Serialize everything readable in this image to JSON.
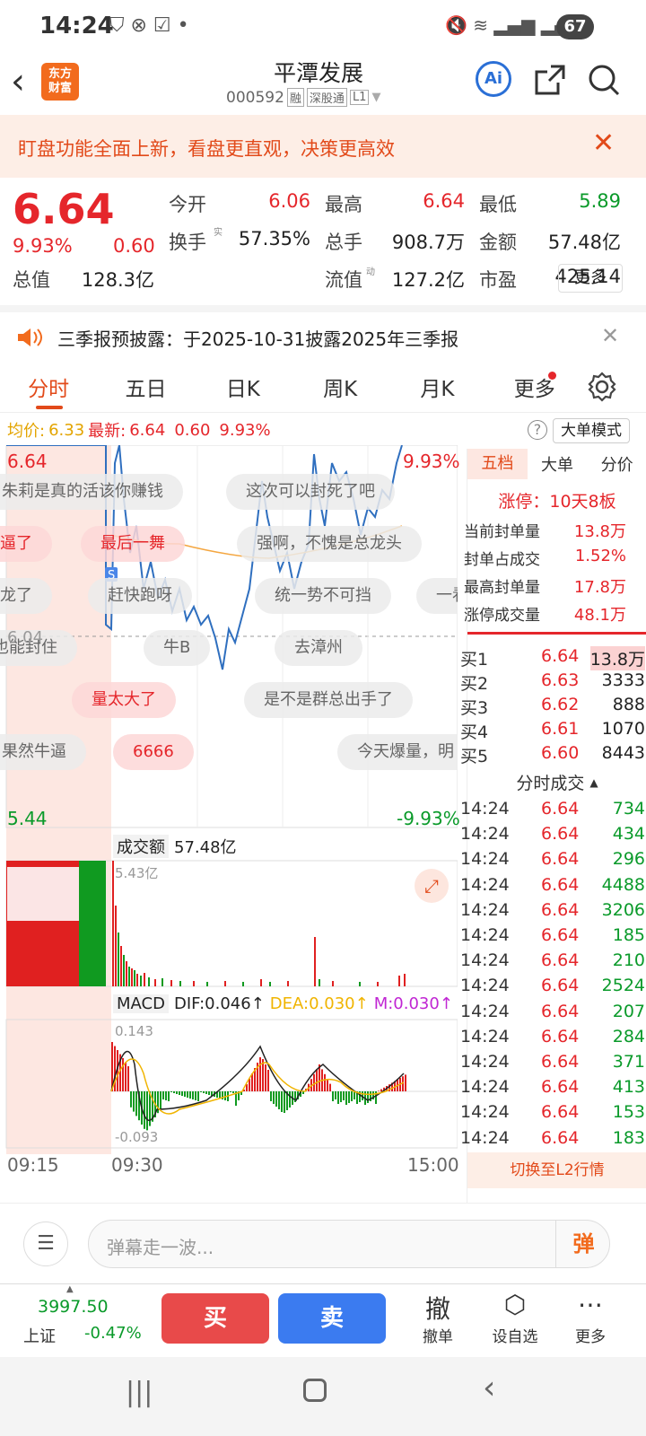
{
  "status": {
    "time": "14:24",
    "battery": "67"
  },
  "header": {
    "title": "平潭发展",
    "code": "000592",
    "tags": [
      "融",
      "深股通",
      "L1"
    ],
    "logo": "东方\n财富",
    "ai": "Ai"
  },
  "notice": {
    "text": "盯盘功能全面上新，看盘更直观，决策更高效"
  },
  "quote": {
    "price": "6.64",
    "pct": "9.93%",
    "chg": "0.60",
    "cells": [
      {
        "label": "今开",
        "value": "6.06",
        "color": "red"
      },
      {
        "label": "最高",
        "value": "6.64",
        "color": "red"
      },
      {
        "label": "最低",
        "value": "5.89",
        "color": "green"
      },
      {
        "label": "换手",
        "value": "57.35%",
        "color": "black"
      },
      {
        "label": "总手",
        "value": "908.7万",
        "color": "black"
      },
      {
        "label": "金额",
        "value": "57.48亿",
        "color": "black"
      },
      {
        "label": "总值",
        "value": "128.3亿",
        "color": "black"
      },
      {
        "label": "流值",
        "value": "127.2亿",
        "color": "black"
      },
      {
        "label": "市盈",
        "value": "425.14",
        "color": "black"
      }
    ],
    "sup_turn": "实",
    "sup_pe": "动",
    "more": "更多"
  },
  "announcement": {
    "text": "三季报预披露：于2025-10-31披露2025年三季报"
  },
  "tabs": [
    "分时",
    "五日",
    "日K",
    "周K",
    "月K",
    "更多"
  ],
  "infobar": {
    "avg_label": "均价:",
    "avg": "6.33",
    "last_label": "最新:",
    "last": "6.64",
    "chg": "0.60",
    "pct": "9.93%",
    "mode": "大单模式"
  },
  "chart": {
    "high": "6.64",
    "high_pct": "9.93%",
    "low": "5.44",
    "low_pct": "-9.93%",
    "mid": "6.04",
    "vol_label": "成交额",
    "vol_value": "57.48亿",
    "vol_max": "5.43亿",
    "macd_label": "MACD",
    "dif": "DIF:0.046↑",
    "dea": "DEA:0.030↑",
    "m": "M:0.030↑",
    "macd_max": "0.143",
    "macd_min": "-0.093",
    "times": [
      "09:15",
      "09:30",
      "15:00"
    ]
  },
  "danmaku": [
    {
      "text": "朱莉是真的活该你赚钱",
      "style": "g"
    },
    {
      "text": "这次可以封死了吧",
      "style": "g"
    },
    {
      "text": "牛逼了",
      "style": "r"
    },
    {
      "text": "最后一舞",
      "style": "r"
    },
    {
      "text": "强啊，不愧是总龙头",
      "style": "g"
    },
    {
      "text": "成龙了",
      "style": "g"
    },
    {
      "text": "赶快跑呀",
      "style": "g"
    },
    {
      "text": "统一势不可挡",
      "style": "g"
    },
    {
      "text": "一看",
      "style": "g"
    },
    {
      "text": "也能封住",
      "style": "g"
    },
    {
      "text": "牛B",
      "style": "g"
    },
    {
      "text": "去漳州",
      "style": "g"
    },
    {
      "text": "量太大了",
      "style": "r"
    },
    {
      "text": "是不是群总出手了",
      "style": "g"
    },
    {
      "text": "果然牛逼",
      "style": "g"
    },
    {
      "text": "6666",
      "style": "r"
    },
    {
      "text": "今天爆量，明",
      "style": "g"
    }
  ],
  "side": {
    "tabs": [
      "五档",
      "大单",
      "分价"
    ],
    "limit": "涨停：10天8板",
    "stats": [
      {
        "label": "当前封单量",
        "value": "13.8万"
      },
      {
        "label": "封单占成交",
        "value": "1.52%"
      },
      {
        "label": "最高封单量",
        "value": "17.8万"
      },
      {
        "label": "涨停成交量",
        "value": "48.1万"
      }
    ],
    "bids": [
      {
        "label": "买1",
        "price": "6.64",
        "vol": "13.8万"
      },
      {
        "label": "买2",
        "price": "6.63",
        "vol": "3333"
      },
      {
        "label": "买3",
        "price": "6.62",
        "vol": "888"
      },
      {
        "label": "买4",
        "price": "6.61",
        "vol": "1070"
      },
      {
        "label": "买5",
        "price": "6.60",
        "vol": "8443"
      }
    ],
    "ticks_title": "分时成交",
    "ticks": [
      {
        "t": "14:24",
        "p": "6.64",
        "v": "734"
      },
      {
        "t": "14:24",
        "p": "6.64",
        "v": "434"
      },
      {
        "t": "14:24",
        "p": "6.64",
        "v": "296"
      },
      {
        "t": "14:24",
        "p": "6.64",
        "v": "4488"
      },
      {
        "t": "14:24",
        "p": "6.64",
        "v": "3206"
      },
      {
        "t": "14:24",
        "p": "6.64",
        "v": "185"
      },
      {
        "t": "14:24",
        "p": "6.64",
        "v": "210"
      },
      {
        "t": "14:24",
        "p": "6.64",
        "v": "2524"
      },
      {
        "t": "14:24",
        "p": "6.64",
        "v": "207"
      },
      {
        "t": "14:24",
        "p": "6.64",
        "v": "284"
      },
      {
        "t": "14:24",
        "p": "6.64",
        "v": "371"
      },
      {
        "t": "14:24",
        "p": "6.64",
        "v": "413"
      },
      {
        "t": "14:24",
        "p": "6.64",
        "v": "153"
      },
      {
        "t": "14:24",
        "p": "6.64",
        "v": "183"
      }
    ],
    "l2": "切换至L2行情"
  },
  "danmu_input": {
    "placeholder": "弹幕走一波...",
    "send": "弹"
  },
  "trade": {
    "index_value": "3997.50",
    "index_name": "上证",
    "index_pct": "-0.47%",
    "buy": "买",
    "sell": "卖",
    "actions": [
      {
        "icon": "撤",
        "label": "撤单"
      },
      {
        "icon": "⬡",
        "label": "设自选"
      },
      {
        "icon": "⋯",
        "label": "更多"
      }
    ]
  }
}
